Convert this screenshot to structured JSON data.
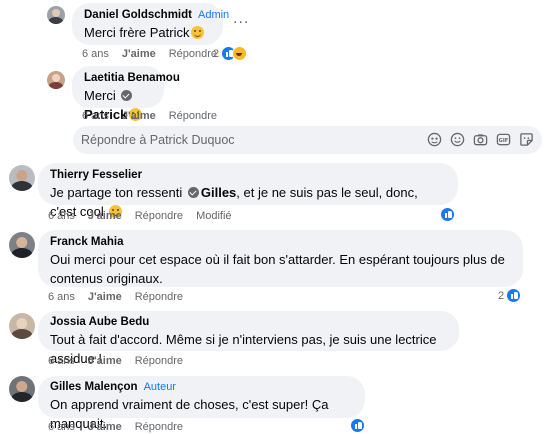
{
  "comments": [
    {
      "author": "Daniel Goldschmidt",
      "role": "Admin",
      "text": "Merci frère Patrick",
      "time": "6 ans",
      "like": "J'aime",
      "reply": "Répondre",
      "reaction_count": "2",
      "more": "..."
    },
    {
      "author": "Laetitia Benamou",
      "text_prefix": "Merci",
      "mention": "Patrick",
      "time": "6 ans",
      "like": "J'aime",
      "reply": "Répondre"
    },
    {
      "author": "Thierry Fesselier",
      "text_prefix": "Je partage ton ressenti",
      "mention": "Gilles",
      "text_suffix": ", et je ne suis pas le seul, donc, c'est cool",
      "time": "6 ans",
      "like": "J'aime",
      "reply": "Répondre",
      "edited": "Modifié"
    },
    {
      "author": "Franck Mahia",
      "text": "Oui merci pour cet espace où il fait bon s'attarder. En espérant toujours plus de contenus originaux.",
      "time": "6 ans",
      "like": "J'aime",
      "reply": "Répondre",
      "reaction_count": "2"
    },
    {
      "author": "Jossia Aube Bedu",
      "text": "Tout à fait d'accord. Même si je n'interviens pas, je suis une lectrice assidue !",
      "time": "6 ans",
      "like": "J'aime",
      "reply": "Répondre"
    },
    {
      "author": "Gilles Malençon",
      "role": "Auteur",
      "text": "On apprend vraiment de choses, c'est super! Ça manquait.",
      "time": "6 ans",
      "like": "J'aime",
      "reply": "Répondre"
    }
  ],
  "reply_box": {
    "placeholder": "Répondre à Patrick Duquoc"
  },
  "icons": {
    "reply_tools": [
      "gif-icon",
      "emoji-icon",
      "camera-icon",
      "sticker-avatar-icon",
      "sticker-icon"
    ]
  },
  "colors": {
    "bubble_bg": "#f0f2f5",
    "meta_text": "#65676b",
    "accent": "#1877f2"
  }
}
